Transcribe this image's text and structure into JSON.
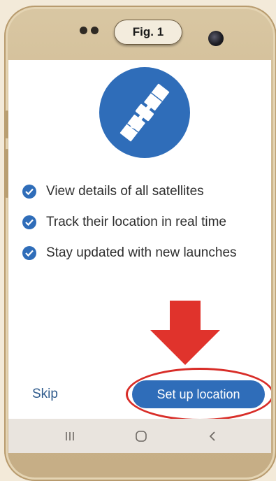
{
  "figure": {
    "label": "Fig. 1"
  },
  "hero": {
    "icon": "satellite-icon",
    "circle_color": "#2f6db9"
  },
  "features": [
    {
      "label": "View details of all satellites",
      "icon": "check-circle-icon"
    },
    {
      "label": "Track their location in real time",
      "icon": "check-circle-icon"
    },
    {
      "label": "Stay updated with new launches",
      "icon": "check-circle-icon"
    }
  ],
  "actions": {
    "skip_label": "Skip",
    "setup_label": "Set up location"
  },
  "annotation": {
    "arrow_color": "#e0332c",
    "ring_color": "#d82d28"
  },
  "navbar": {
    "recent_icon": "recent-apps-icon",
    "home_icon": "home-icon",
    "back_icon": "back-icon"
  },
  "colors": {
    "accent": "#2f6db9",
    "link": "#2f5b8c",
    "navbar_bg": "#e9e4de"
  }
}
